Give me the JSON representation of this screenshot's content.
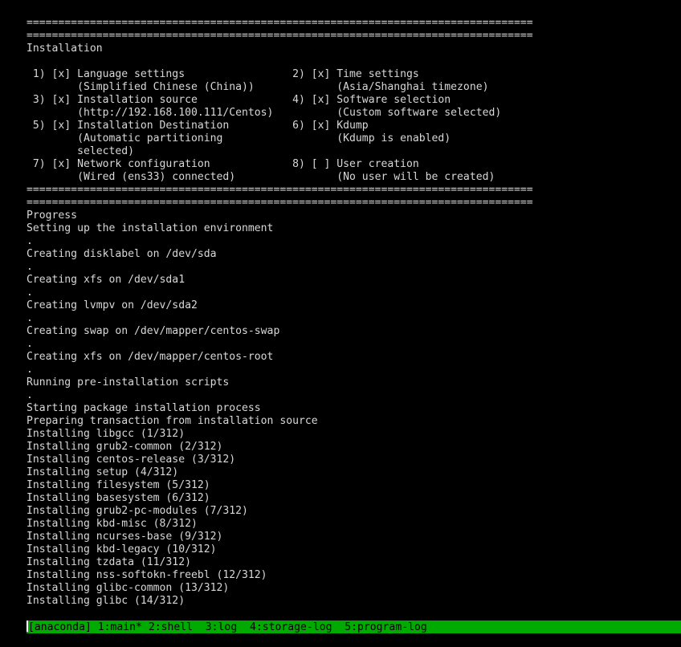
{
  "colors": {
    "background": "#000000",
    "text": "#d8d8d8",
    "status_bar": "#00aa00",
    "status_text": "#000000"
  },
  "separator": "================================================================================",
  "hub": {
    "title": "Installation",
    "spokes": [
      {
        "num": "1)",
        "status": "[x]",
        "label": "Language settings",
        "desc": [
          "(Simplified Chinese (China))"
        ]
      },
      {
        "num": "2)",
        "status": "[x]",
        "label": "Time settings",
        "desc": [
          "(Asia/Shanghai timezone)"
        ]
      },
      {
        "num": "3)",
        "status": "[x]",
        "label": "Installation source",
        "desc": [
          "(http://192.168.100.111/Centos)"
        ]
      },
      {
        "num": "4)",
        "status": "[x]",
        "label": "Software selection",
        "desc": [
          "(Custom software selected)"
        ]
      },
      {
        "num": "5)",
        "status": "[x]",
        "label": "Installation Destination",
        "desc": [
          "(Automatic partitioning",
          "selected)"
        ]
      },
      {
        "num": "6)",
        "status": "[x]",
        "label": "Kdump",
        "desc": [
          "(Kdump is enabled)"
        ]
      },
      {
        "num": "7)",
        "status": "[x]",
        "label": "Network configuration",
        "desc": [
          "(Wired (ens33) connected)"
        ]
      },
      {
        "num": "8)",
        "status": "[ ]",
        "label": "User creation",
        "desc": [
          "(No user will be created)"
        ]
      }
    ]
  },
  "progress": {
    "title": "Progress",
    "lines": [
      "Setting up the installation environment",
      ".",
      "Creating disklabel on /dev/sda",
      ".",
      "Creating xfs on /dev/sda1",
      ".",
      "Creating lvmpv on /dev/sda2",
      ".",
      "Creating swap on /dev/mapper/centos-swap",
      ".",
      "Creating xfs on /dev/mapper/centos-root",
      ".",
      "Running pre-installation scripts",
      ".",
      "Starting package installation process",
      "Preparing transaction from installation source",
      "Installing libgcc (1/312)",
      "Installing grub2-common (2/312)",
      "Installing centos-release (3/312)",
      "Installing setup (4/312)",
      "Installing filesystem (5/312)",
      "Installing basesystem (6/312)",
      "Installing grub2-pc-modules (7/312)",
      "Installing kbd-misc (8/312)",
      "Installing ncurses-base (9/312)",
      "Installing kbd-legacy (10/312)",
      "Installing tzdata (11/312)",
      "Installing nss-softokn-freebl (12/312)",
      "Installing glibc-common (13/312)",
      "Installing glibc (14/312)"
    ]
  },
  "tmux": {
    "session": "[anaconda]",
    "windows": [
      {
        "label": "1:main*"
      },
      {
        "label": "2:shell"
      },
      {
        "label": "3:log"
      },
      {
        "label": "4:storage-log"
      },
      {
        "label": "5:program-log"
      }
    ]
  }
}
